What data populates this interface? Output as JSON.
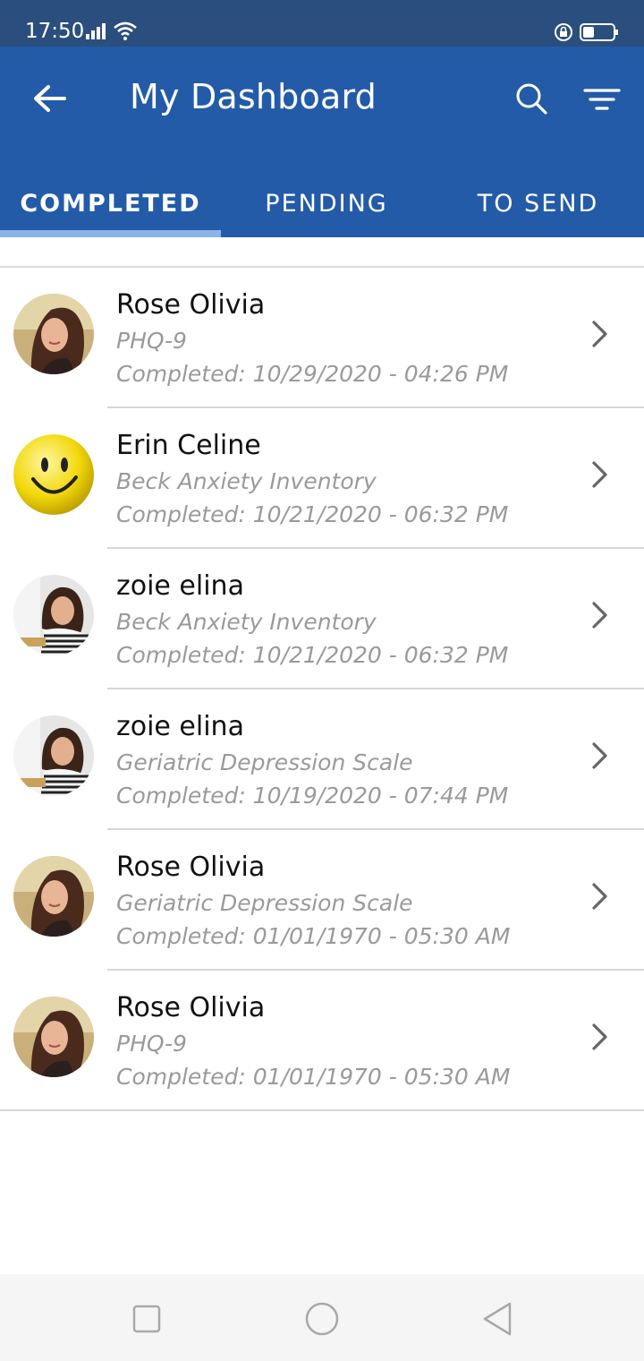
{
  "status_bar": {
    "time": "17:50",
    "icons": [
      "signal-icon",
      "wifi-icon",
      "rotation-lock-icon",
      "battery-icon"
    ]
  },
  "app_bar": {
    "title": "My Dashboard",
    "icons": [
      "back-arrow-icon",
      "search-icon",
      "filter-icon"
    ],
    "background": "#235ba8"
  },
  "tabs": [
    {
      "label": "COMPLETED",
      "active": true
    },
    {
      "label": "PENDING",
      "active": false
    },
    {
      "label": "TO SEND",
      "active": false
    }
  ],
  "list": [
    {
      "name": "Rose Olivia",
      "form": "PHQ-9",
      "completed": "Completed: 10/29/2020 - 04:26 PM",
      "avatar": "woman-photo"
    },
    {
      "name": "Erin Celine",
      "form": "Beck Anxiety Inventory",
      "completed": "Completed: 10/21/2020 - 06:32 PM",
      "avatar": "smiley-face"
    },
    {
      "name": "zoie elina",
      "form": "Beck Anxiety Inventory",
      "completed": "Completed: 10/21/2020 - 06:32 PM",
      "avatar": "girl-photo"
    },
    {
      "name": "zoie elina",
      "form": "Geriatric Depression Scale",
      "completed": "Completed: 10/19/2020 - 07:44 PM",
      "avatar": "girl-photo"
    },
    {
      "name": "Rose Olivia",
      "form": "Geriatric Depression Scale",
      "completed": "Completed: 01/01/1970 - 05:30 AM",
      "avatar": "woman-photo"
    },
    {
      "name": "Rose Olivia",
      "form": "PHQ-9",
      "completed": "Completed: 01/01/1970 - 05:30 AM",
      "avatar": "woman-photo"
    }
  ],
  "nav_bar": {
    "icons": [
      "recent-apps-icon",
      "home-icon",
      "back-icon"
    ]
  },
  "colors": {
    "status_bar": "#2a4f7e",
    "app_bar": "#235ba8",
    "tab_indicator": "#8ab4e8",
    "secondary_text": "#9a9a9a"
  }
}
